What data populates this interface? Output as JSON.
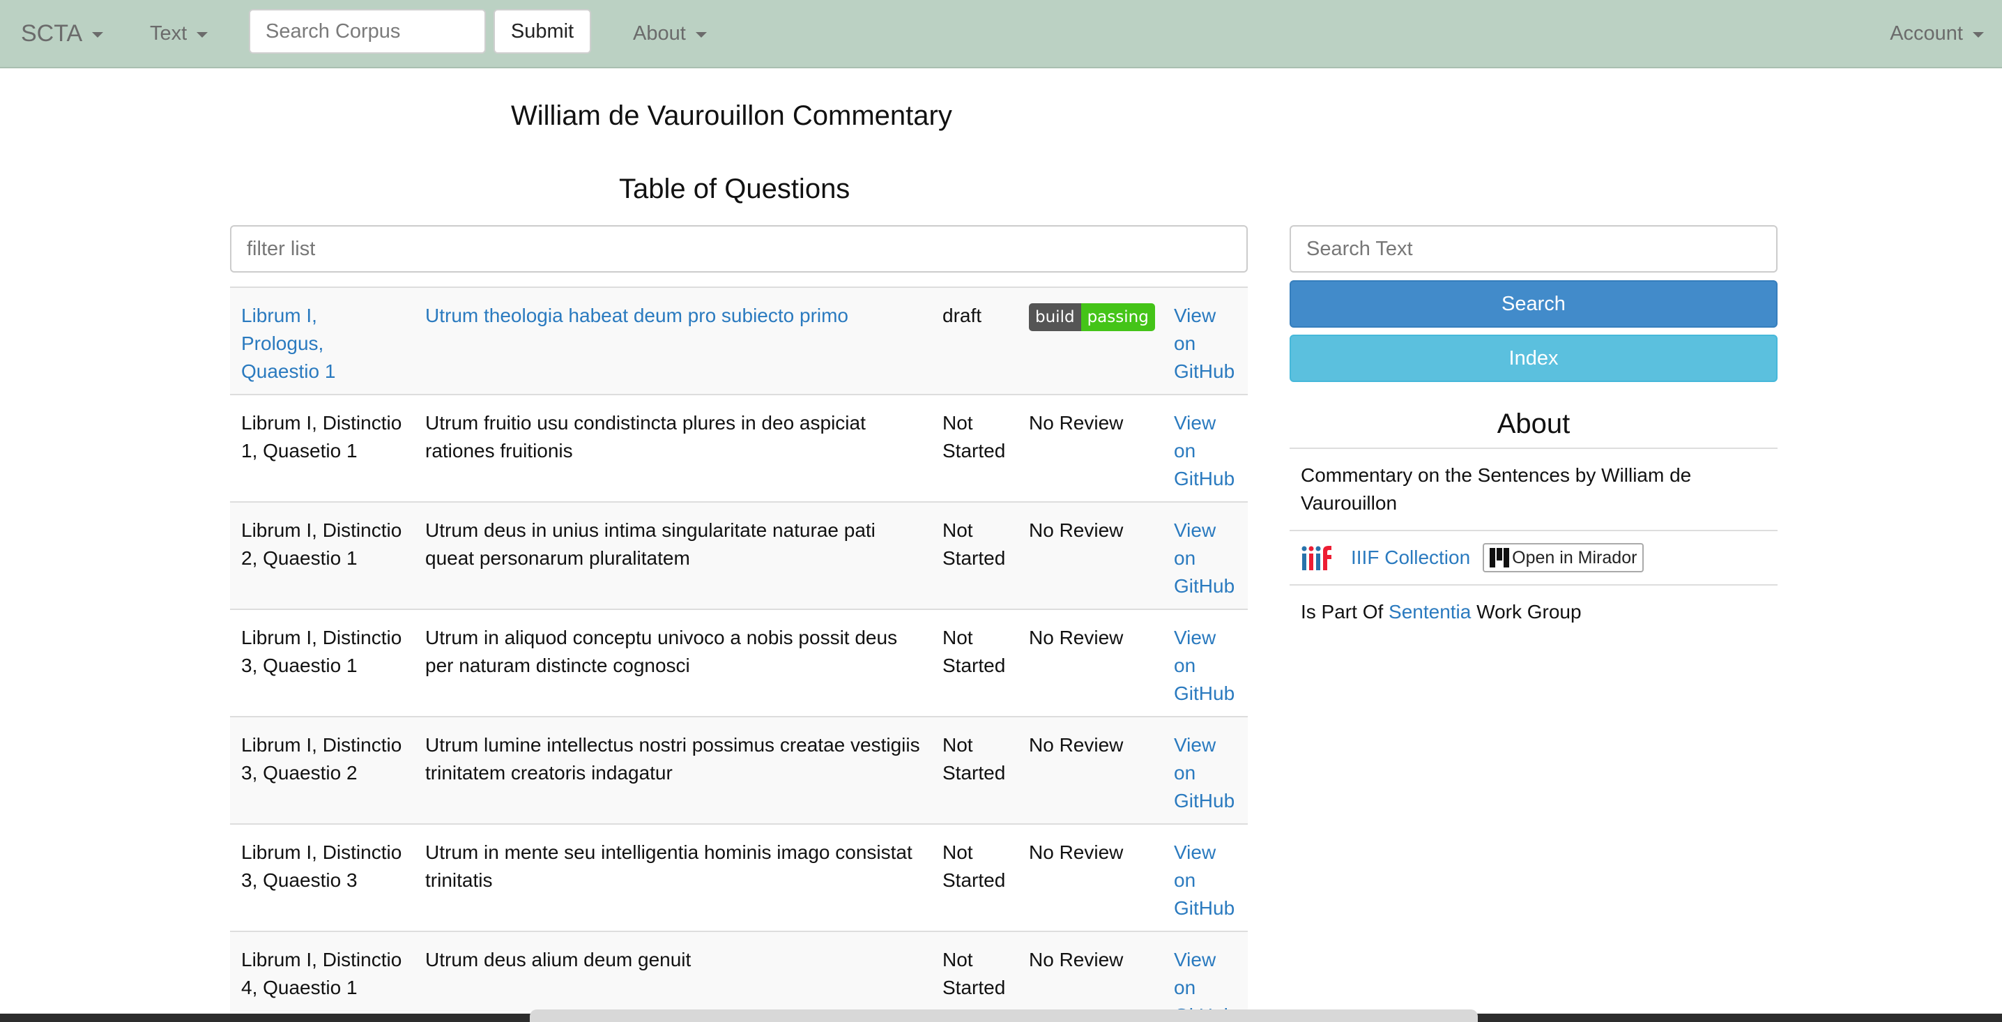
{
  "navbar": {
    "brand": "SCTA",
    "text_menu": "Text",
    "search_placeholder": "Search Corpus",
    "submit_label": "Submit",
    "about_menu": "About",
    "account_menu": "Account"
  },
  "page": {
    "title": "William de Vaurouillon Commentary",
    "toc_title": "Table of Questions",
    "filter_placeholder": "filter list"
  },
  "questions": [
    {
      "ref": "Librum I, Prologus, Quaestio 1",
      "title": "Utrum theologia habeat deum pro subiecto primo",
      "status": "draft",
      "review": "",
      "badge": {
        "left": "build",
        "right": "passing"
      },
      "github": "View on GitHub",
      "linked": true
    },
    {
      "ref": "Librum I, Distinctio 1, Quasetio 1",
      "title": "Utrum fruitio usu condistincta plures in deo aspiciat rationes fruitionis",
      "status": "Not Started",
      "review": "No Review",
      "github": "View on GitHub",
      "linked": false
    },
    {
      "ref": "Librum I, Distinctio 2, Quaestio 1",
      "title": "Utrum deus in unius intima singularitate naturae pati queat personarum pluralitatem",
      "status": "Not Started",
      "review": "No Review",
      "github": "View on GitHub",
      "linked": false
    },
    {
      "ref": "Librum I, Distinctio 3, Quaestio 1",
      "title": "Utrum in aliquod conceptu univoco a nobis possit deus per naturam distincte cognosci",
      "status": "Not Started",
      "review": "No Review",
      "github": "View on GitHub",
      "linked": false
    },
    {
      "ref": "Librum I, Distinctio 3, Quaestio 2",
      "title": "Utrum lumine intellectus nostri possimus creatae vestigiis trinitatem creatoris indagatur",
      "status": "Not Started",
      "review": "No Review",
      "github": "View on GitHub",
      "linked": false
    },
    {
      "ref": "Librum I, Distinctio 3, Quaestio 3",
      "title": "Utrum in mente seu intelligentia hominis imago consistat trinitatis",
      "status": "Not Started",
      "review": "No Review",
      "github": "View on GitHub",
      "linked": false
    },
    {
      "ref": "Librum I, Distinctio 4, Quaestio 1",
      "title": "Utrum deus alium deum genuit",
      "status": "Not Started",
      "review": "No Review",
      "github": "View on GitHub",
      "linked": false
    }
  ],
  "sidebar": {
    "search_placeholder": "Search Text",
    "search_button": "Search",
    "index_button": "Index",
    "about_title": "About",
    "description": "Commentary on the Sentences by William de Vaurouillon",
    "iiif_link": "IIIF Collection",
    "mirador_button": "Open in Mirador",
    "part_of_prefix": "Is Part Of",
    "part_of_link": "Sententia",
    "part_of_suffix": "Work Group"
  },
  "colors": {
    "navbar_bg": "#bbd1c3",
    "link": "#2a7abf",
    "primary_button": "#428bca",
    "info_button": "#5bc0de",
    "badge_passing": "#44c418"
  }
}
